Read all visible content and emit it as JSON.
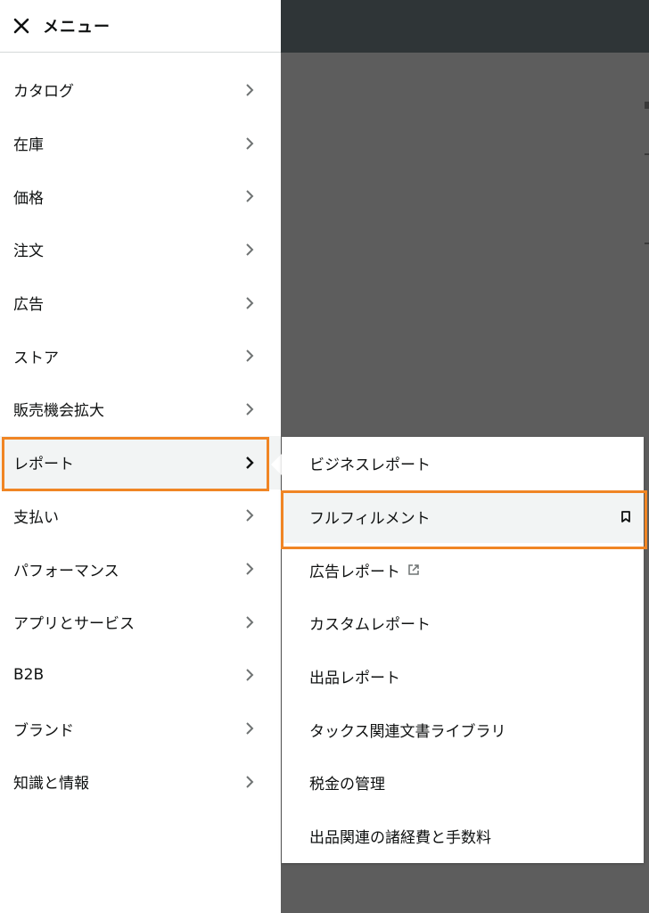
{
  "menu": {
    "title": "メニュー",
    "items": [
      {
        "label": "カタログ"
      },
      {
        "label": "在庫"
      },
      {
        "label": "価格"
      },
      {
        "label": "注文"
      },
      {
        "label": "広告"
      },
      {
        "label": "ストア"
      },
      {
        "label": "販売機会拡大"
      },
      {
        "label": "レポート",
        "active": true
      },
      {
        "label": "支払い"
      },
      {
        "label": "パフォーマンス"
      },
      {
        "label": "アプリとサービス"
      },
      {
        "label": "B2B"
      },
      {
        "label": "ブランド"
      },
      {
        "label": "知識と情報"
      }
    ]
  },
  "submenu": {
    "items": [
      {
        "label": "ビジネスレポート"
      },
      {
        "label": "フルフィルメント",
        "active": true,
        "icon": "bookmark-icon"
      },
      {
        "label": "広告レポート",
        "icon": "external-link-icon"
      },
      {
        "label": "カスタムレポート"
      },
      {
        "label": "出品レポート"
      },
      {
        "label": "タックス関連文書ライブラリ"
      },
      {
        "label": "税金の管理"
      },
      {
        "label": "出品関連の諸経費と手数料"
      }
    ]
  },
  "colors": {
    "highlight": "#f08524",
    "header_dark": "#2f3537",
    "overlay": "#5d5d5d"
  }
}
